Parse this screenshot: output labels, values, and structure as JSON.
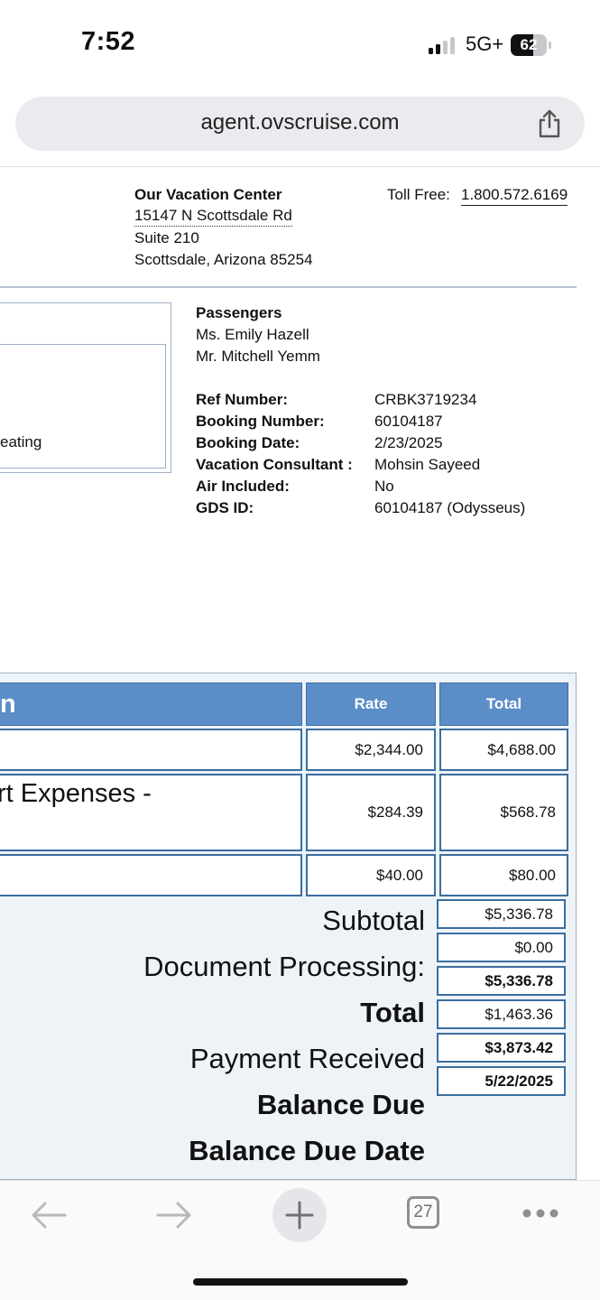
{
  "status_bar": {
    "time": "7:52",
    "network": "5G+",
    "battery_level": "62",
    "battery_fraction": 0.62
  },
  "browser": {
    "url": "agent.ovscruise.com",
    "icons": {
      "share": "share-icon",
      "back": "back-arrow-icon",
      "forward": "forward-arrow-icon",
      "new_tab": "plus-icon",
      "menu": "more-dots-icon"
    },
    "tab_count": "27"
  },
  "header": {
    "company": "Our Vacation Center",
    "street": "15147 N Scottsdale Rd",
    "suite": "Suite 210",
    "city": "Scottsdale, Arizona 85254",
    "toll_free_label": "Toll Free:",
    "toll_free_phone": "1.800.572.6169"
  },
  "left_box": {
    "visible_text": "eating"
  },
  "passengers": {
    "heading": "Passengers",
    "names": [
      "Ms. Emily Hazell",
      "Mr. Mitchell Yemm"
    ]
  },
  "booking": {
    "ref_label": "Ref Number:",
    "ref_value": "CRBK3719234",
    "booking_number_label": "Booking Number:",
    "booking_number_value": "60104187",
    "booking_date_label": "Booking Date:",
    "booking_date_value": "2/23/2025",
    "consultant_label": "Vacation Consultant :",
    "consultant_value": "Mohsin Sayeed",
    "air_label": "Air Included:",
    "air_value": "No",
    "gds_label": "GDS ID:",
    "gds_value": "60104187 (Odysseus)"
  },
  "table": {
    "headers": {
      "description": "n",
      "rate": "Rate",
      "total": "Total"
    },
    "rows": [
      {
        "description": "",
        "rate": "$2,344.00",
        "total": "$4,688.00"
      },
      {
        "description": "rt Expenses -",
        "rate": "$284.39",
        "total": "$568.78"
      },
      {
        "description": "",
        "rate": "$40.00",
        "total": "$80.00"
      }
    ]
  },
  "summary": {
    "labels": {
      "subtotal": "Subtotal",
      "document_processing": "Document Processing:",
      "total": "Total",
      "payment_received": "Payment Received",
      "balance_due": "Balance Due",
      "balance_due_date": "Balance Due Date"
    },
    "values": [
      "$5,336.78",
      "$0.00",
      "$5,336.78",
      "$1,463.36",
      "$3,873.42",
      "5/22/2025"
    ]
  },
  "colors": {
    "header_blue": "#5b8ec7",
    "cell_border": "#3b6e9e",
    "table_bg": "#eef3f8"
  }
}
